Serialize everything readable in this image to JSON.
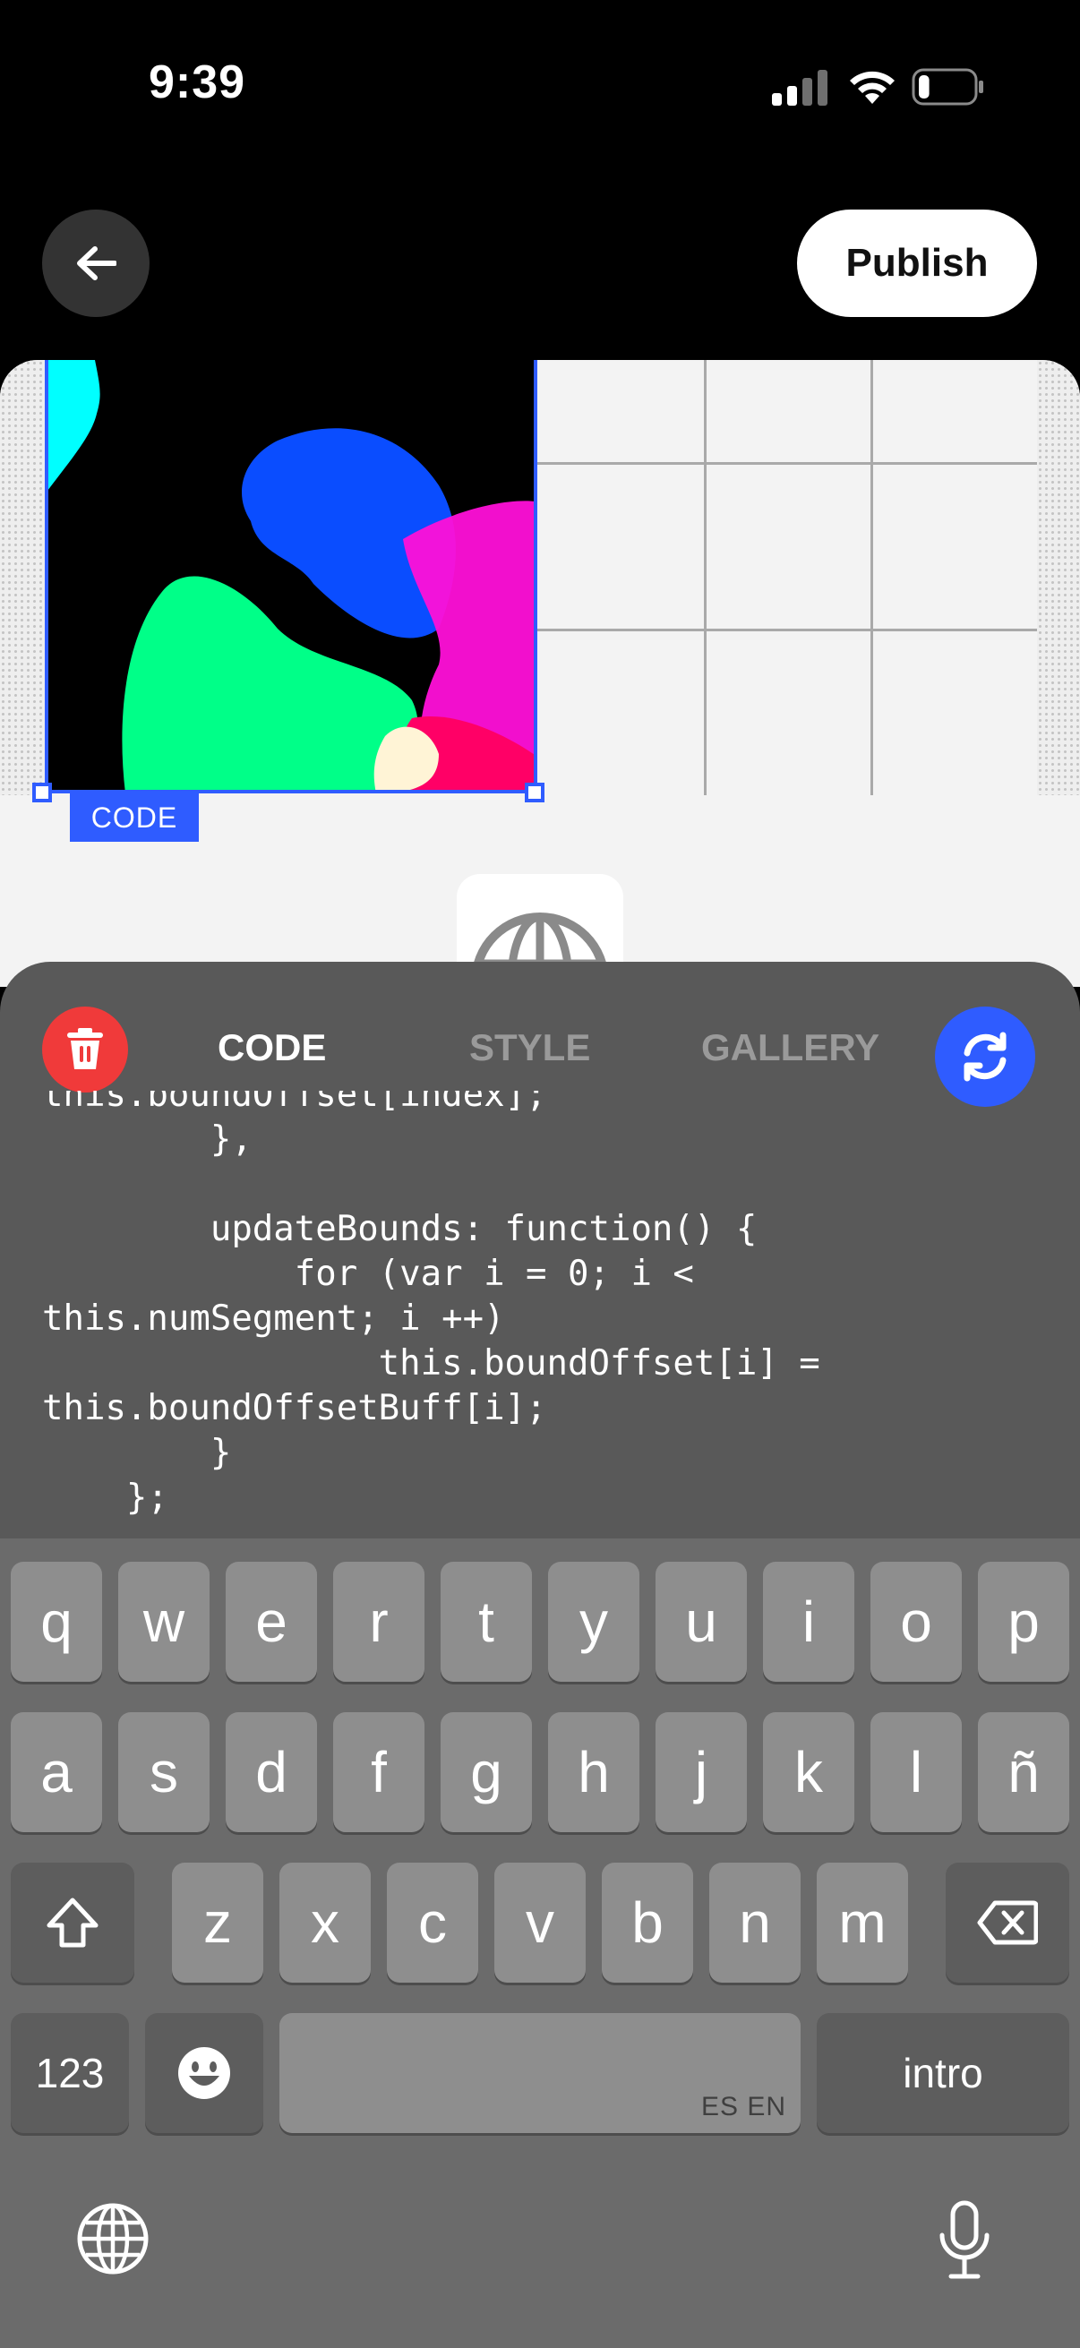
{
  "status_bar": {
    "time": "9:39",
    "signal_icon": "cellular-signal-icon",
    "wifi_icon": "wifi-icon",
    "battery_icon": "battery-icon",
    "battery_level": 0.2
  },
  "top_bar": {
    "back_icon": "arrow-left-icon",
    "publish_label": "Publish"
  },
  "canvas": {
    "selection_label": "CODE",
    "widget_icon": "globe-icon"
  },
  "editor": {
    "delete_icon": "trash-icon",
    "refresh_icon": "refresh-icon",
    "tabs": [
      {
        "label": "CODE",
        "active": true
      },
      {
        "label": "STYLE",
        "active": false
      },
      {
        "label": "GALLERY",
        "active": false
      }
    ],
    "code_lines": [
      "this.boundOffset[index];",
      "        },",
      "",
      "        updateBounds: function() {",
      "            for (var i = 0; i <",
      "this.numSegment; i ++)",
      "                this.boundOffset[i] =",
      "this.boundOffsetBuff[i];",
      "        }",
      "    };"
    ]
  },
  "keyboard": {
    "row1": [
      "q",
      "w",
      "e",
      "r",
      "t",
      "y",
      "u",
      "i",
      "o",
      "p"
    ],
    "row2": [
      "a",
      "s",
      "d",
      "f",
      "g",
      "h",
      "j",
      "k",
      "l",
      "ñ"
    ],
    "row3": [
      "z",
      "x",
      "c",
      "v",
      "b",
      "n",
      "m"
    ],
    "numbers_label": "123",
    "emoji_icon": "emoji-icon",
    "space_hint": "ES EN",
    "return_label": "intro",
    "shift_icon": "shift-icon",
    "backspace_icon": "backspace-icon",
    "globe_icon": "globe-icon",
    "mic_icon": "microphone-icon"
  },
  "colors": {
    "accent": "#2f5cff",
    "delete": "#f03a3a",
    "panel": "#595959",
    "keyboard": "#6b6b6b"
  }
}
